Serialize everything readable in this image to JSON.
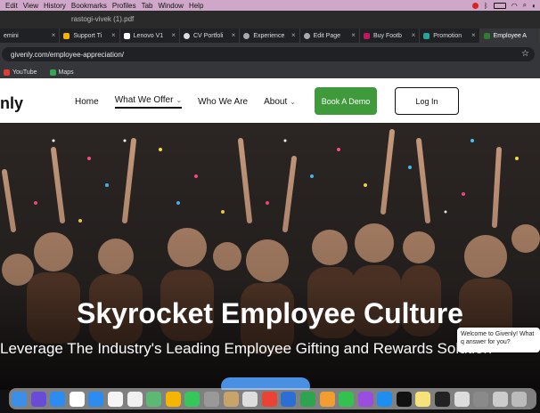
{
  "menubar": {
    "items": [
      "Edit",
      "View",
      "History",
      "Bookmarks",
      "Profiles",
      "Tab",
      "Window",
      "Help"
    ]
  },
  "titlebar": {
    "doc": "rastogi-vivek (1).pdf"
  },
  "tabs": [
    {
      "label": "emini"
    },
    {
      "label": "Support Ti"
    },
    {
      "label": "Lenovo V1"
    },
    {
      "label": "CV Portfoli"
    },
    {
      "label": "Experience"
    },
    {
      "label": "Edit Page"
    },
    {
      "label": "Buy Footb"
    },
    {
      "label": "Promotion"
    },
    {
      "label": "Employee A"
    }
  ],
  "address": {
    "url": "givenly.com/employee-appreciation/"
  },
  "bookmarks": [
    {
      "label": "YouTube",
      "color": "#e53935"
    },
    {
      "label": "Maps",
      "color": "#34a853"
    }
  ],
  "site": {
    "logo": "nly",
    "nav": [
      {
        "label": "Home",
        "chevron": ""
      },
      {
        "label": "What We Offer",
        "chevron": "⌄"
      },
      {
        "label": "Who We Are",
        "chevron": ""
      },
      {
        "label": "About",
        "chevron": "⌄"
      }
    ],
    "demo_button": "Book A Demo",
    "login_button": "Log In",
    "brand_green": "#3e9a3a"
  },
  "hero": {
    "title": "Skyrocket Employee Culture",
    "subtitle": "Leverage The Industry's Leading Employee Gifting and Rewards Solution"
  },
  "chat": {
    "text": "Welcome to Givenly! What q answer for you?"
  },
  "dock": {
    "apps": [
      {
        "name": "finder-icon",
        "color": "#3b8fe8"
      },
      {
        "name": "siri-icon",
        "color": "#6a4bd8"
      },
      {
        "name": "safari-icon",
        "color": "#2d8cf0"
      },
      {
        "name": "calendar-icon",
        "color": "#ffffff"
      },
      {
        "name": "mail-icon",
        "color": "#2d8cf0"
      },
      {
        "name": "reminders-icon",
        "color": "#f5f5f5"
      },
      {
        "name": "notes-icon",
        "color": "#f0f0f0"
      },
      {
        "name": "maps-icon",
        "color": "#5bb974"
      },
      {
        "name": "photos-icon",
        "color": "#f4b400"
      },
      {
        "name": "messages-icon",
        "color": "#35c759"
      },
      {
        "name": "launchpad-icon",
        "color": "#999999"
      },
      {
        "name": "sketch-icon",
        "color": "#c8a46a"
      },
      {
        "name": "textedit-icon",
        "color": "#dddddd"
      },
      {
        "name": "chrome-icon",
        "color": "#ea4335"
      },
      {
        "name": "keynote-icon",
        "color": "#2b6fd6"
      },
      {
        "name": "numbers-icon",
        "color": "#2ea44f"
      },
      {
        "name": "pages-icon",
        "color": "#f29d2f"
      },
      {
        "name": "facetime-icon",
        "color": "#33c24d"
      },
      {
        "name": "podcasts-icon",
        "color": "#9b4de0"
      },
      {
        "name": "appstore-icon",
        "color": "#1f8ef1"
      },
      {
        "name": "tv-icon",
        "color": "#111111"
      },
      {
        "name": "stickies-icon",
        "color": "#f6e27a"
      },
      {
        "name": "terminal-icon",
        "color": "#222222"
      },
      {
        "name": "preview-icon",
        "color": "#dddddd"
      },
      {
        "name": "system-prefs-icon",
        "color": "#8a8a8a"
      },
      {
        "name": "downloads-icon",
        "color": "#cccccc"
      },
      {
        "name": "trash-icon",
        "color": "#bbbbbb"
      }
    ]
  }
}
